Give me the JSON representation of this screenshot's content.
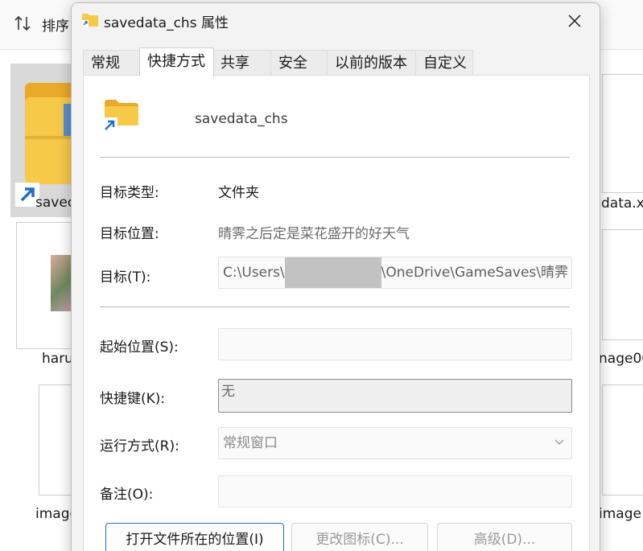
{
  "explorer": {
    "sort_label": "排序",
    "files": [
      {
        "label": "savec"
      },
      {
        "label": "data.x"
      },
      {
        "label": "haru"
      },
      {
        "label": "nage00"
      },
      {
        "label": "image"
      },
      {
        "label": "image"
      }
    ]
  },
  "dialog": {
    "title": "savedata_chs 属性",
    "tabs": [
      "常规",
      "快捷方式",
      "共享",
      "安全",
      "以前的版本",
      "自定义"
    ],
    "active_tab": "快捷方式",
    "shortcut_name": "savedata_chs",
    "fields": {
      "target_type_label": "目标类型:",
      "target_type_value": "文件夹",
      "target_location_label": "目标位置:",
      "target_location_value": "晴霁之后定是菜花盛开的好天气",
      "target_label": "目标(T):",
      "target_value_prefix": "C:\\Users\\",
      "target_value_suffix": "\\OneDrive\\GameSaves\\晴霁",
      "start_in_label": "起始位置(S):",
      "start_in_value": "",
      "hotkey_label": "快捷键(K):",
      "hotkey_value": "无",
      "run_label": "运行方式(R):",
      "run_value": "常规窗口",
      "comment_label": "备注(O):",
      "comment_value": ""
    },
    "buttons": {
      "open_location": "打开文件所在的位置(I)",
      "change_icon": "更改图标(C)...",
      "advanced": "高级(D)..."
    }
  },
  "colors": {
    "folder": "#f7c948",
    "folder_dark": "#e9a92a",
    "shortcut_arrow": "#1f6fc5",
    "primary_border": "#2f6db5"
  }
}
